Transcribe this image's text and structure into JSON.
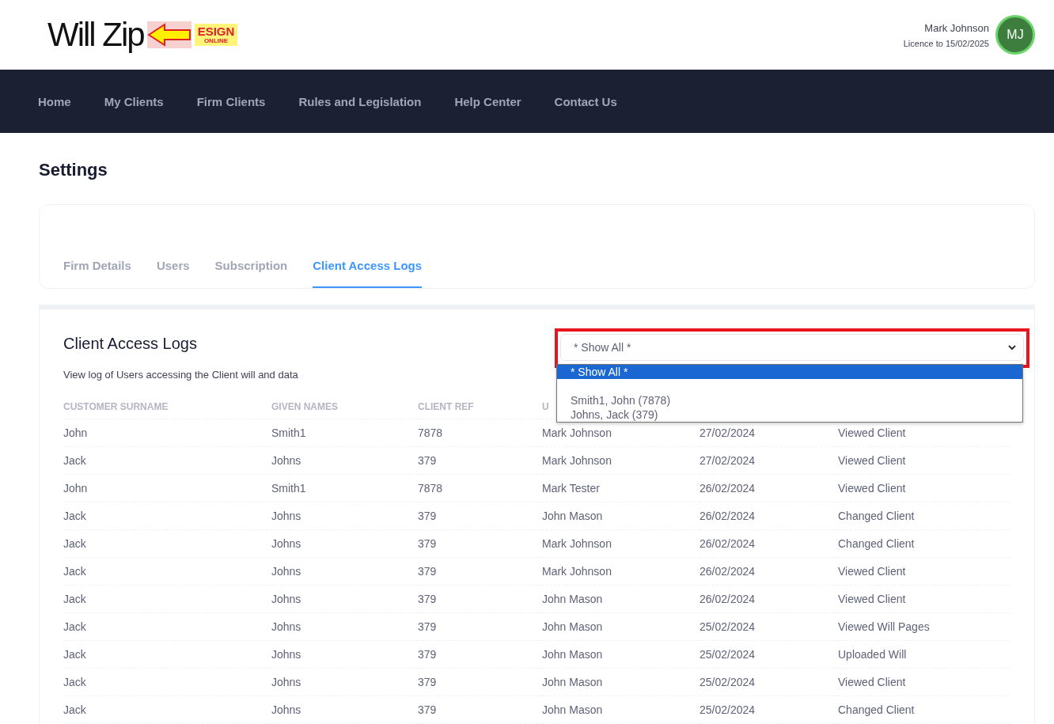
{
  "logo": {
    "wordmark": "Will Zip",
    "badge_top": "ESIGN",
    "badge_bottom": "ONLINE"
  },
  "user": {
    "name": "Mark Johnson",
    "licence": "Licence to 15/02/2025",
    "initials": "MJ"
  },
  "nav": [
    {
      "label": "Home"
    },
    {
      "label": "My Clients"
    },
    {
      "label": "Firm Clients"
    },
    {
      "label": "Rules and Legislation"
    },
    {
      "label": "Help Center"
    },
    {
      "label": "Contact Us"
    }
  ],
  "page_title": "Settings",
  "tabs": [
    {
      "label": "Firm Details",
      "selected": false
    },
    {
      "label": "Users",
      "selected": false
    },
    {
      "label": "Subscription",
      "selected": false
    },
    {
      "label": "Client Access Logs",
      "selected": true
    }
  ],
  "panel": {
    "title": "Client Access Logs",
    "subtitle": "View log of Users accessing the Client will and data"
  },
  "client_filter": {
    "value": "* Show All *",
    "highlighted": true,
    "expanded": true,
    "options": [
      {
        "label": "* Show All *",
        "selected": true
      },
      {
        "label": "Smith1, John (7878)",
        "selected": false
      },
      {
        "label": "Johns, Jack (379)",
        "selected": false
      }
    ]
  },
  "table": {
    "columns": [
      "CUSTOMER SURNAME",
      "GIVEN NAMES",
      "CLIENT REF",
      "U"
    ],
    "rows": [
      [
        "John",
        "Smith1",
        "7878",
        "Mark Johnson",
        "27/02/2024",
        "Viewed Client"
      ],
      [
        "Jack",
        "Johns",
        "379",
        "Mark Johnson",
        "27/02/2024",
        "Viewed Client"
      ],
      [
        "John",
        "Smith1",
        "7878",
        "Mark Tester",
        "26/02/2024",
        "Viewed Client"
      ],
      [
        "Jack",
        "Johns",
        "379",
        "John Mason",
        "26/02/2024",
        "Changed Client"
      ],
      [
        "Jack",
        "Johns",
        "379",
        "Mark Johnson",
        "26/02/2024",
        "Changed Client"
      ],
      [
        "Jack",
        "Johns",
        "379",
        "Mark Johnson",
        "26/02/2024",
        "Viewed Client"
      ],
      [
        "Jack",
        "Johns",
        "379",
        "John Mason",
        "26/02/2024",
        "Viewed Client"
      ],
      [
        "Jack",
        "Johns",
        "379",
        "John Mason",
        "25/02/2024",
        "Viewed Will Pages"
      ],
      [
        "Jack",
        "Johns",
        "379",
        "John Mason",
        "25/02/2024",
        "Uploaded Will"
      ],
      [
        "Jack",
        "Johns",
        "379",
        "John Mason",
        "25/02/2024",
        "Viewed Client"
      ],
      [
        "Jack",
        "Johns",
        "379",
        "John Mason",
        "25/02/2024",
        "Changed Client"
      ]
    ]
  }
}
